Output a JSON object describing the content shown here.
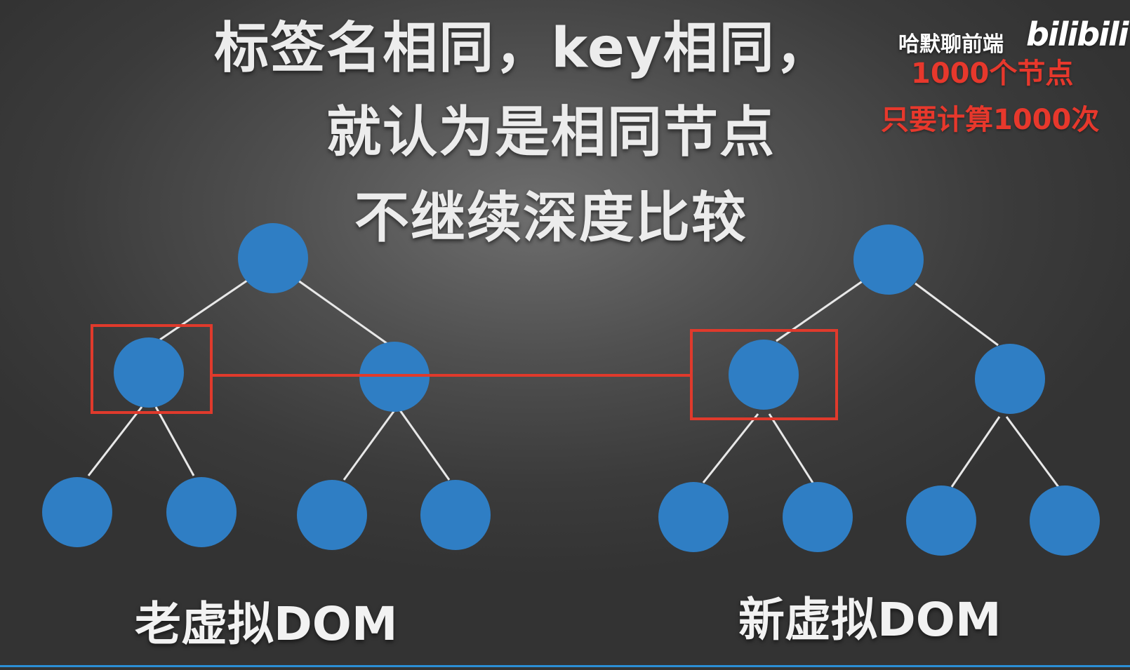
{
  "title": {
    "line1": "标签名相同，key相同，",
    "line2": "就认为是相同节点",
    "line3": "不继续深度比较"
  },
  "watermark": {
    "channel": "哈默聊前端",
    "logo": "bilibili"
  },
  "notes": {
    "line1": "1000个节点",
    "line2": "只要计算1000次"
  },
  "trees": {
    "old_label": "老虚拟DOM",
    "new_label": "新虚拟DOM"
  },
  "colors": {
    "node": "#2f7ec4",
    "edge": "#e8e8e8",
    "highlight": "#e03a2c",
    "note": "#e7382c"
  }
}
